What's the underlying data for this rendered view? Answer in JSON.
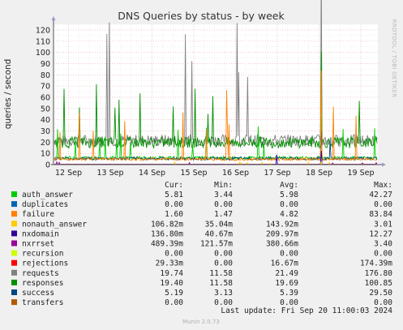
{
  "chart_data": {
    "type": "line",
    "title": "DNS Queries by status - by week",
    "ylabel": "queries / second",
    "ylim": [
      0,
      125
    ],
    "yticks": [
      0,
      10,
      20,
      30,
      40,
      50,
      60,
      70,
      80,
      90,
      100,
      110,
      120
    ],
    "xticks": [
      "12 Sep",
      "13 Sep",
      "14 Sep",
      "15 Sep",
      "16 Sep",
      "17 Sep",
      "18 Sep",
      "19 Sep"
    ],
    "grid": true,
    "series": [
      {
        "name": "auth_answer",
        "color": "#00cc00",
        "cur": "5.81",
        "min": "3.44",
        "avg": "5.98",
        "max": "42.27"
      },
      {
        "name": "duplicates",
        "color": "#0066b3",
        "cur": "0.00",
        "min": "0.00",
        "avg": "0.00",
        "max": "0.00"
      },
      {
        "name": "failure",
        "color": "#ff8000",
        "cur": "1.60",
        "min": "1.47",
        "avg": "4.82",
        "max": "83.84"
      },
      {
        "name": "nonauth_answer",
        "color": "#ffcc00",
        "cur": "106.82m",
        "min": "35.04m",
        "avg": "143.92m",
        "max": "3.01"
      },
      {
        "name": "nxdomain",
        "color": "#330099",
        "cur": "136.80m",
        "min": "40.67m",
        "avg": "209.97m",
        "max": "12.27"
      },
      {
        "name": "nxrrset",
        "color": "#990099",
        "cur": "489.39m",
        "min": "121.57m",
        "avg": "380.66m",
        "max": "3.40"
      },
      {
        "name": "recursion",
        "color": "#ccff00",
        "cur": "0.00",
        "min": "0.00",
        "avg": "0.00",
        "max": "0.00"
      },
      {
        "name": "rejections",
        "color": "#ff0000",
        "cur": "29.33m",
        "min": "0.00",
        "avg": "16.67m",
        "max": "174.39m"
      },
      {
        "name": "requests",
        "color": "#808080",
        "cur": "19.74",
        "min": "11.58",
        "avg": "21.49",
        "max": "176.80"
      },
      {
        "name": "responses",
        "color": "#008f00",
        "cur": "19.40",
        "min": "11.58",
        "avg": "19.69",
        "max": "100.85"
      },
      {
        "name": "success",
        "color": "#00487d",
        "cur": "5.19",
        "min": "3.13",
        "avg": "5.39",
        "max": "29.50"
      },
      {
        "name": "transfers",
        "color": "#b35a00",
        "cur": "0.00",
        "min": "0.00",
        "avg": "0.00",
        "max": "0.00"
      }
    ]
  },
  "legend_headers": {
    "cur": "Cur:",
    "min": "Min:",
    "avg": "Avg:",
    "max": "Max:"
  },
  "last_update": "Last update: Fri Sep 20 11:00:03 2024",
  "side_label": "RRDTOOL / TOBI OETIKER",
  "footer": "Munin 2.0.73"
}
